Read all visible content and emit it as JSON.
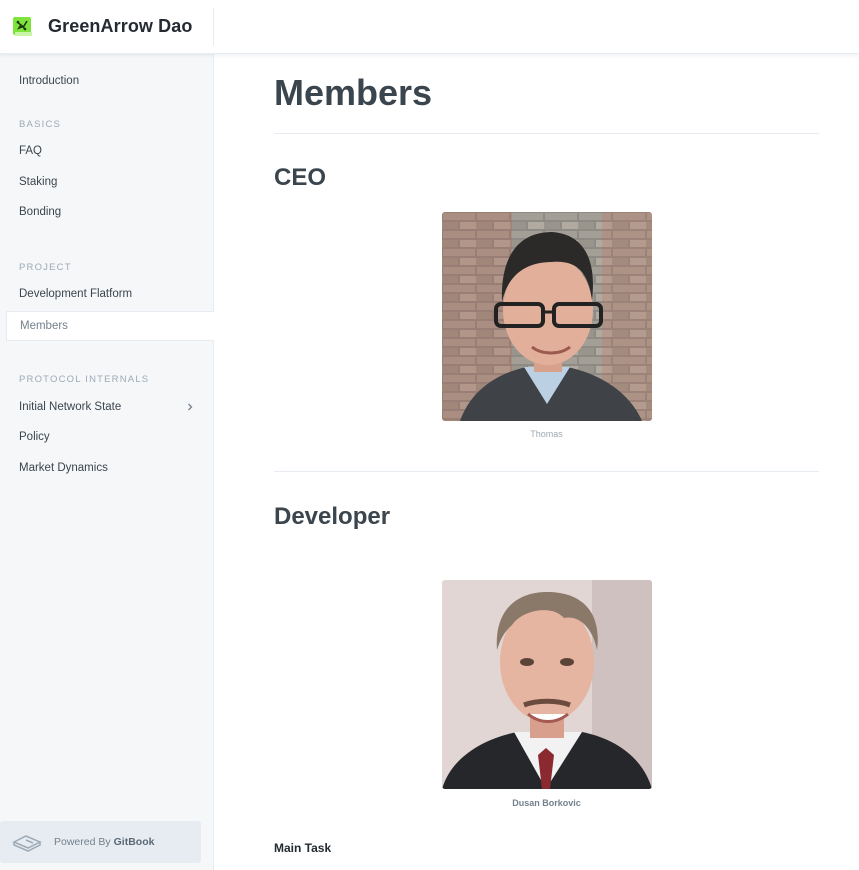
{
  "header": {
    "title": "GreenArrow Dao",
    "logo_icon": "greenarrow-logo-icon",
    "logo_color": "#7ee33a"
  },
  "sidebar": {
    "items": [
      {
        "label": "Introduction"
      },
      {
        "section": "BASICS"
      },
      {
        "label": "FAQ"
      },
      {
        "label": "Staking"
      },
      {
        "label": "Bonding"
      },
      {
        "section": "PROJECT"
      },
      {
        "label": "Development Flatform"
      },
      {
        "label": "Members",
        "active": true
      },
      {
        "section": "PROTOCOL INTERNALS"
      },
      {
        "label": "Initial Network State",
        "expandable": true
      },
      {
        "label": "Policy"
      },
      {
        "label": "Market Dynamics"
      }
    ],
    "powered_prefix": "Powered By",
    "powered_brand": "GitBook",
    "accent": "#74818d"
  },
  "main": {
    "title": "Members",
    "sections": [
      {
        "heading": "CEO",
        "caption": "Thomas"
      },
      {
        "heading": "Developer",
        "caption": "Dusan Borkovic"
      }
    ],
    "main_task": "Main Task"
  }
}
